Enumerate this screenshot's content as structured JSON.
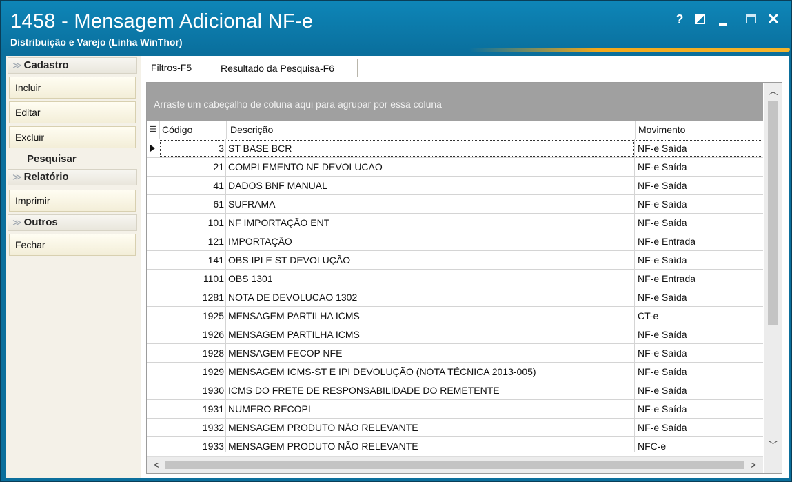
{
  "window": {
    "title": "1458 - Mensagem Adicional NF-e",
    "subtitle": "Distribuição e Varejo (Linha WinThor)",
    "controls": {
      "help": "?",
      "close": "✕"
    }
  },
  "sidebar": {
    "groups": [
      {
        "label": "Cadastro",
        "items": [
          "Incluir",
          "Editar",
          "Excluir"
        ]
      },
      {
        "label": "Pesquisar"
      },
      {
        "label": "Relatório",
        "items": [
          "Imprimir"
        ]
      },
      {
        "label": "Outros",
        "items": [
          "Fechar"
        ]
      }
    ]
  },
  "tabs": [
    "Filtros-F5",
    "Resultado da Pesquisa-F6"
  ],
  "grid": {
    "group_hint": "Arraste um cabeçalho de coluna aqui para agrupar por essa coluna",
    "columns": [
      "Código",
      "Descrição",
      "Movimento"
    ],
    "rows": [
      {
        "codigo": "3",
        "descricao": "ST BASE BCR",
        "movimento": "NF-e Saída"
      },
      {
        "codigo": "21",
        "descricao": "COMPLEMENTO NF DEVOLUCAO",
        "movimento": "NF-e Saída"
      },
      {
        "codigo": "41",
        "descricao": "DADOS BNF MANUAL",
        "movimento": "NF-e Saída"
      },
      {
        "codigo": "61",
        "descricao": "SUFRAMA",
        "movimento": "NF-e Saída"
      },
      {
        "codigo": "101",
        "descricao": "NF IMPORTAÇÃO ENT",
        "movimento": "NF-e Saída"
      },
      {
        "codigo": "121",
        "descricao": "IMPORTAÇÃO",
        "movimento": "NF-e Entrada"
      },
      {
        "codigo": "141",
        "descricao": "OBS IPI E ST DEVOLUÇÃO",
        "movimento": "NF-e Saída"
      },
      {
        "codigo": "1101",
        "descricao": "OBS 1301",
        "movimento": "NF-e Entrada"
      },
      {
        "codigo": "1281",
        "descricao": "NOTA  DE DEVOLUCAO 1302",
        "movimento": "NF-e Saída"
      },
      {
        "codigo": "1925",
        "descricao": "MENSAGEM PARTILHA ICMS",
        "movimento": "CT-e"
      },
      {
        "codigo": "1926",
        "descricao": "MENSAGEM PARTILHA ICMS",
        "movimento": "NF-e Saída"
      },
      {
        "codigo": "1928",
        "descricao": "MENSAGEM FECOP NFE",
        "movimento": "NF-e Saída"
      },
      {
        "codigo": "1929",
        "descricao": "MENSAGEM ICMS-ST E IPI DEVOLUÇÃO (NOTA TÉCNICA 2013-005)",
        "movimento": "NF-e Saída"
      },
      {
        "codigo": "1930",
        "descricao": "ICMS DO FRETE DE RESPONSABILIDADE DO REMETENTE",
        "movimento": "NF-e Saída"
      },
      {
        "codigo": "1931",
        "descricao": "NUMERO RECOPI",
        "movimento": "NF-e Saída"
      },
      {
        "codigo": "1932",
        "descricao": "MENSAGEM PRODUTO NÃO RELEVANTE",
        "movimento": "NF-e Saída"
      },
      {
        "codigo": "1933",
        "descricao": "MENSAGEM PRODUTO NÃO RELEVANTE",
        "movimento": "NFC-e"
      }
    ]
  },
  "icons": {
    "chevron": "chevron-down-double-icon",
    "row_indicator": "current-row-arrow-icon",
    "column_chooser": "column-chooser-icon"
  }
}
